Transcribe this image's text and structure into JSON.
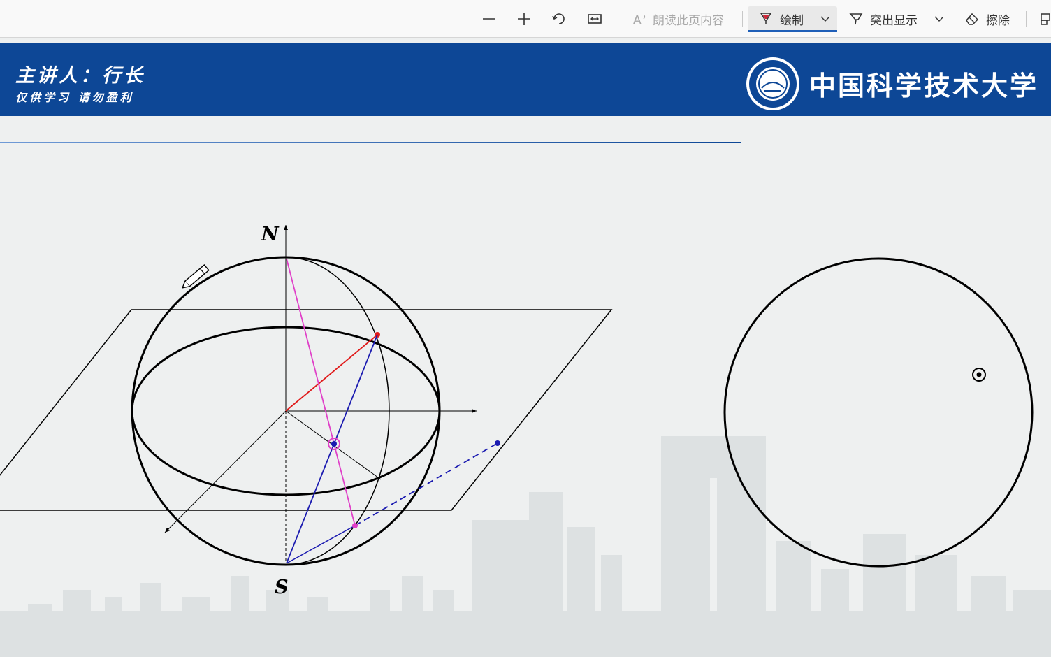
{
  "toolbar": {
    "zoom_out_icon": "minus-icon",
    "zoom_in_icon": "plus-icon",
    "rotate_icon": "rotate-icon",
    "fit_icon": "fit-width-icon",
    "read_aloud_label": "朗读此页内容",
    "draw_label": "绘制",
    "highlight_label": "突出显示",
    "erase_label": "擦除",
    "accent_color": "#1f5fb8"
  },
  "banner": {
    "speaker": "主讲人：行长",
    "note": "仅供学习  请勿盈利",
    "university": "中国科学技术大学",
    "color": "#0d4796"
  },
  "figure": {
    "label_north": "N",
    "label_south": "S"
  }
}
